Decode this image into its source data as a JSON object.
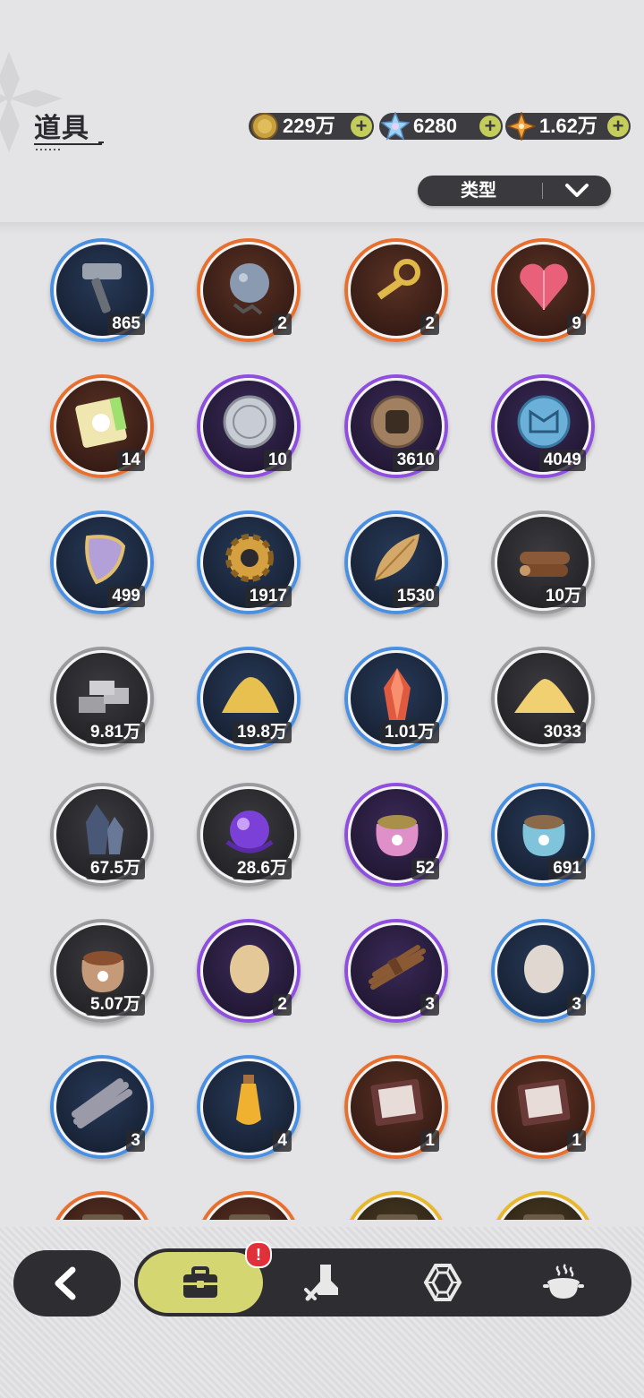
{
  "header": {
    "title": "道具"
  },
  "currencies": [
    {
      "name": "gold-coin-icon",
      "value": "229万",
      "plus": "+"
    },
    {
      "name": "crystal-icon",
      "value": "6280",
      "plus": "+"
    },
    {
      "name": "star-shard-icon",
      "value": "1.62万",
      "plus": "+"
    }
  ],
  "filter": {
    "label": "类型"
  },
  "items": [
    {
      "icon": "hammer-icon",
      "rarity": "blue",
      "count": "865"
    },
    {
      "icon": "spiked-ball-icon",
      "rarity": "orange",
      "count": "2"
    },
    {
      "icon": "golden-key-icon",
      "rarity": "orange",
      "count": "2"
    },
    {
      "icon": "pink-crystal-heart-icon",
      "rarity": "orange",
      "count": "9"
    },
    {
      "icon": "rainbow-ticket-icon",
      "rarity": "orange",
      "count": "14"
    },
    {
      "icon": "silver-coin-icon",
      "rarity": "purple",
      "count": "10"
    },
    {
      "icon": "fist-coin-icon",
      "rarity": "purple",
      "count": "3610"
    },
    {
      "icon": "blue-emblem-coin-icon",
      "rarity": "purple",
      "count": "4049"
    },
    {
      "icon": "scale-shield-icon",
      "rarity": "blue",
      "count": "499"
    },
    {
      "icon": "gear-icon",
      "rarity": "blue",
      "count": "1917"
    },
    {
      "icon": "golden-leaf-icon",
      "rarity": "blue",
      "count": "1530"
    },
    {
      "icon": "wood-logs-icon",
      "rarity": "gray",
      "count": "10万"
    },
    {
      "icon": "stone-bricks-icon",
      "rarity": "gray",
      "count": "9.81万"
    },
    {
      "icon": "gold-sand-pile-icon",
      "rarity": "blue",
      "count": "19.8万"
    },
    {
      "icon": "red-crystal-icon",
      "rarity": "blue",
      "count": "1.01万"
    },
    {
      "icon": "sand-pile-icon",
      "rarity": "gray",
      "count": "3033"
    },
    {
      "icon": "dark-crystal-icon",
      "rarity": "gray",
      "count": "67.5万"
    },
    {
      "icon": "purple-orb-icon",
      "rarity": "gray",
      "count": "28.6万"
    },
    {
      "icon": "pink-food-bag-icon",
      "rarity": "purple",
      "count": "52"
    },
    {
      "icon": "blue-food-bag-icon",
      "rarity": "blue",
      "count": "691"
    },
    {
      "icon": "brown-food-bag-icon",
      "rarity": "gray",
      "count": "5.07万"
    },
    {
      "icon": "golden-egg-icon",
      "rarity": "purple",
      "count": "2"
    },
    {
      "icon": "twig-bundle-icon",
      "rarity": "purple",
      "count": "3"
    },
    {
      "icon": "white-egg-icon",
      "rarity": "blue",
      "count": "3"
    },
    {
      "icon": "feather-bundle-icon",
      "rarity": "blue",
      "count": "3"
    },
    {
      "icon": "potion-vial-icon",
      "rarity": "blue",
      "count": "4"
    },
    {
      "icon": "character-book-icon",
      "rarity": "orange",
      "count": "1"
    },
    {
      "icon": "character-book-icon",
      "rarity": "orange",
      "count": "1"
    },
    {
      "icon": "partial-item-icon",
      "rarity": "orange",
      "count": ""
    },
    {
      "icon": "partial-item-icon",
      "rarity": "orange",
      "count": ""
    },
    {
      "icon": "partial-item-icon",
      "rarity": "gold",
      "count": ""
    },
    {
      "icon": "partial-item-icon",
      "rarity": "gold",
      "count": ""
    }
  ],
  "nav": {
    "back": "back-arrow-icon",
    "tabs": [
      {
        "name": "bag-icon",
        "active": true,
        "badge": "!"
      },
      {
        "name": "boot-sword-icon",
        "active": false
      },
      {
        "name": "hexagon-gem-icon",
        "active": false
      },
      {
        "name": "pot-icon",
        "active": false
      }
    ]
  },
  "colors": {
    "blue": "#4a90e2",
    "orange": "#e86f2e",
    "purple": "#8f4ee0",
    "gray": "#9a9a9e",
    "gold": "#e8b82a",
    "accent": "#d4d672",
    "dark": "#2e2e32"
  }
}
